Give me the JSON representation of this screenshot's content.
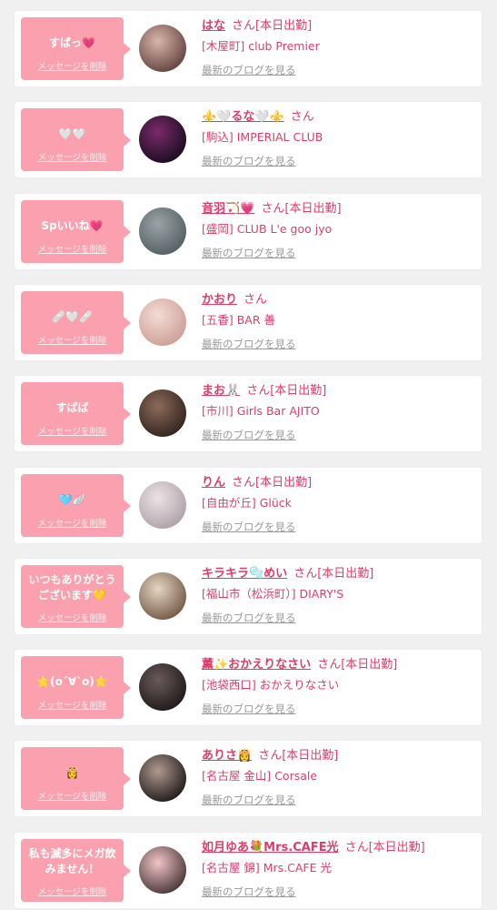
{
  "delete_label": "メッセージを削除",
  "blog_label": "最新のブログを見る",
  "theme": {
    "accent": "#e23b67",
    "bubble": "#fba0ae",
    "muted": "#999999",
    "background": "#f0f0f0"
  },
  "cards": [
    {
      "message": "すばっ💗",
      "name": "はな",
      "suffix": "さん[本日出勤]",
      "shop": "[木屋町] club Premier",
      "avatar": {
        "c1": "#d8b6ad",
        "c2": "#5a3a36"
      }
    },
    {
      "message": "🤍🤍",
      "name": "⚜️🤍るな🤍⚜️",
      "suffix": "さん",
      "shop": "[駒込] IMPERIAL CLUB",
      "avatar": {
        "c1": "#7a2a6a",
        "c2": "#120a1a"
      }
    },
    {
      "message": "Spいいね💗",
      "name": "音羽🏹💗",
      "suffix": "さん[本日出勤]",
      "shop": "[盛岡] CLUB L'e goo jyo",
      "avatar": {
        "c1": "#9aa3a6",
        "c2": "#4f5a5e"
      }
    },
    {
      "message": "🩹🤍🩹",
      "name": "かおり",
      "suffix": "さん",
      "shop": "[五香] BAR 善",
      "avatar": {
        "c1": "#f4dcd6",
        "c2": "#c99a92"
      }
    },
    {
      "message": "すばば",
      "name": "まお🐰",
      "suffix": "さん[本日出勤]",
      "shop": "[市川] Girls Bar AJITO",
      "avatar": {
        "c1": "#8c6a5a",
        "c2": "#2a1e1a"
      }
    },
    {
      "message": "🩵🪽",
      "name": "りん",
      "suffix": "さん[本日出勤]",
      "shop": "[自由が丘] Glück",
      "avatar": {
        "c1": "#ece3e6",
        "c2": "#a99ca3"
      }
    },
    {
      "message": "いつもありがとう\nございます💛",
      "name": "キラキラ🫧めい",
      "suffix": "さん[本日出勤]",
      "shop": "[福山市（松浜町）] DIARY'S",
      "avatar": {
        "c1": "#e6d6c2",
        "c2": "#6a4e3e"
      }
    },
    {
      "message": "⭐️(o´∀`o)⭐️",
      "name": "薫✨おかえりなさい",
      "suffix": "さん[本日出勤]",
      "shop": "[池袋西口] おかえりなさい",
      "avatar": {
        "c1": "#6a5a5a",
        "c2": "#1a1414"
      }
    },
    {
      "message": "👸",
      "name": "ありさ👸",
      "suffix": "さん[本日出勤]",
      "shop": "[名古屋 金山] Corsale",
      "avatar": {
        "c1": "#b09a90",
        "c2": "#141010"
      }
    },
    {
      "message": "私も滅多にメガ飲\nみません！",
      "name": "如月ゆあ💐Mrs.CAFE光",
      "suffix": "さん[本日出勤]",
      "shop": "[名古屋 錦] Mrs.CAFE 光",
      "avatar": {
        "c1": "#f2c4c8",
        "c2": "#3a2a2a"
      }
    }
  ]
}
